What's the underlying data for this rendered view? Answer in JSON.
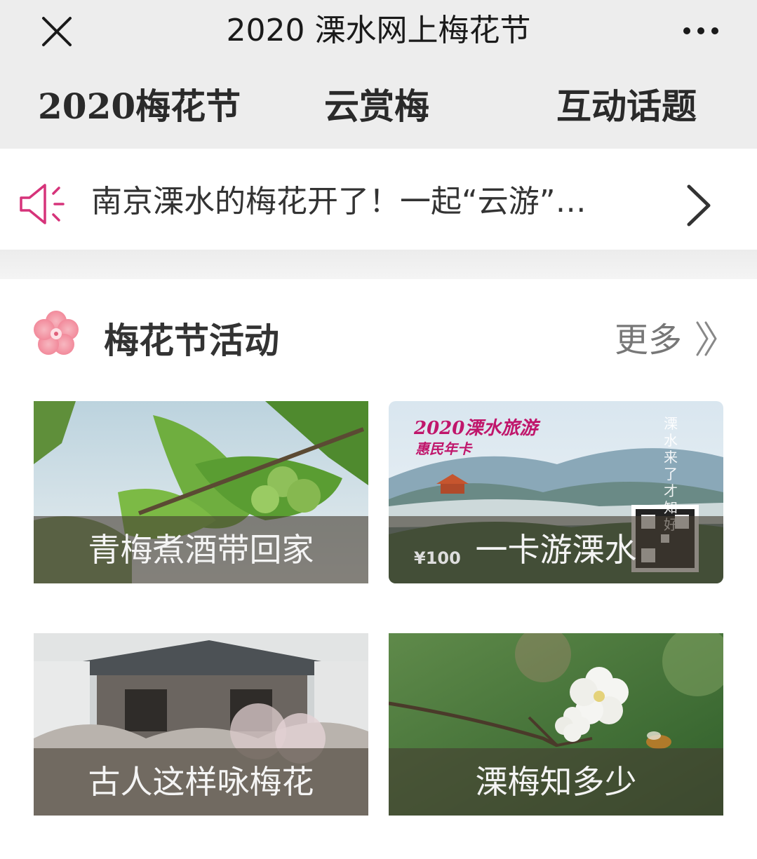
{
  "app": {
    "title": "2020 溧水网上梅花节",
    "close_icon": "close-icon",
    "more_icon": "more-dots-icon"
  },
  "nav": {
    "tabs": [
      {
        "label": "2020梅花节"
      },
      {
        "label": "云赏梅"
      },
      {
        "label": "互动话题"
      }
    ]
  },
  "notice": {
    "icon": "speaker-icon",
    "text": "南京溧水的梅花开了！一起“云游”…",
    "arrow_icon": "chevron-right-icon"
  },
  "section": {
    "icon": "plum-blossom-icon",
    "title": "梅花节活动",
    "more_label": "更多",
    "more_icon": "double-chevron-right-icon"
  },
  "cards": [
    {
      "caption": "青梅煮酒带回家",
      "image": "green-plums-photo"
    },
    {
      "caption": "一卡游溧水",
      "image": "tourism-card-photo",
      "card_title": "2020溧水旅游",
      "card_subtitle": "惠民年卡",
      "card_side_text": "溧水来了才知好",
      "price": "¥100"
    },
    {
      "caption": "古人这样咏梅花",
      "image": "ancient-building-photo"
    },
    {
      "caption": "溧梅知多少",
      "image": "white-plum-blossom-photo"
    }
  ],
  "colors": {
    "bar_bg": "#ededed",
    "speaker_pink": "#d6337a",
    "caption_overlay": "rgba(70,62,50,0.62)"
  }
}
